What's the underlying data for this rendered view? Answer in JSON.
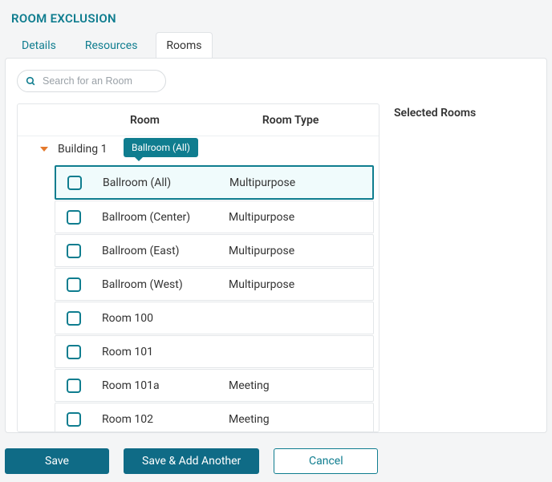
{
  "page_title": "ROOM EXCLUSION",
  "tabs": {
    "details": "Details",
    "resources": "Resources",
    "rooms": "Rooms"
  },
  "search": {
    "placeholder": "Search for an Room"
  },
  "headers": {
    "room": "Room",
    "room_type": "Room Type"
  },
  "group": {
    "name": "Building 1",
    "tooltip": "Ballroom (All)"
  },
  "rows": [
    {
      "name": "Ballroom (All)",
      "type": "Multipurpose",
      "selected": true
    },
    {
      "name": "Ballroom (Center)",
      "type": "Multipurpose",
      "selected": false
    },
    {
      "name": "Ballroom (East)",
      "type": "Multipurpose",
      "selected": false
    },
    {
      "name": "Ballroom (West)",
      "type": "Multipurpose",
      "selected": false
    },
    {
      "name": "Room 100",
      "type": "",
      "selected": false
    },
    {
      "name": "Room 101",
      "type": "",
      "selected": false
    },
    {
      "name": "Room 101a",
      "type": "Meeting",
      "selected": false
    },
    {
      "name": "Room 102",
      "type": "Meeting",
      "selected": false
    }
  ],
  "selected_rooms_label": "Selected Rooms",
  "buttons": {
    "save": "Save",
    "save_add": "Save & Add Another",
    "cancel": "Cancel"
  },
  "colors": {
    "accent": "#0f7d8f",
    "caret": "#e4792c"
  }
}
